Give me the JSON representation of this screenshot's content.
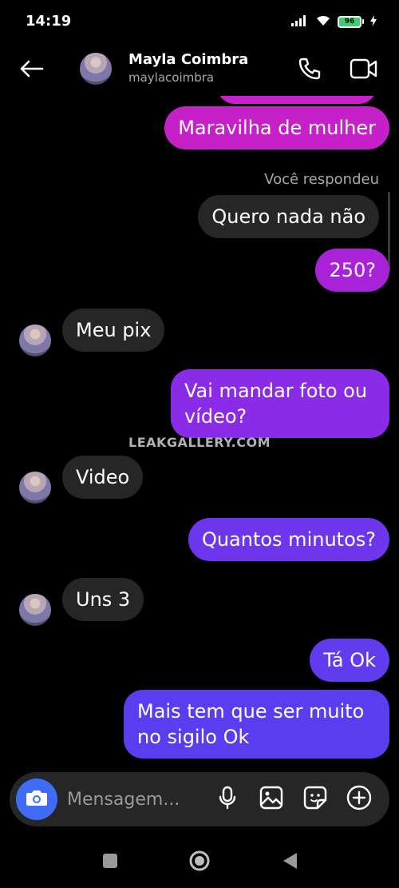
{
  "status": {
    "time": "14:19",
    "battery": "96"
  },
  "header": {
    "name": "Mayla Coimbra",
    "username": "maylacoimbra"
  },
  "replied_label": "Você respondeu",
  "watermark": "LEAKGALLERY.COM",
  "messages": [
    {
      "text": "Maravilha de mulher",
      "from": "me"
    },
    {
      "text": "Quero nada não",
      "from": "them"
    },
    {
      "text": "250?",
      "from": "me"
    },
    {
      "text": "Meu pix",
      "from": "them"
    },
    {
      "text": "Vai mandar foto ou vídeo?",
      "from": "me"
    },
    {
      "text": "Video",
      "from": "them"
    },
    {
      "text": "Quantos minutos?",
      "from": "me"
    },
    {
      "text": "Uns 3",
      "from": "them"
    },
    {
      "text": "Tá Ok",
      "from": "me"
    },
    {
      "text": "Mais tem que ser muito no sigilo Ok",
      "from": "me"
    }
  ],
  "composer": {
    "placeholder": "Mensagem..."
  },
  "colors": {
    "outgoing_top": "#c620c9",
    "outgoing_mid": "#8a2be8",
    "outgoing_bottom": "#5b3df0",
    "incoming": "#262626",
    "camera": "#3f6cf4"
  }
}
